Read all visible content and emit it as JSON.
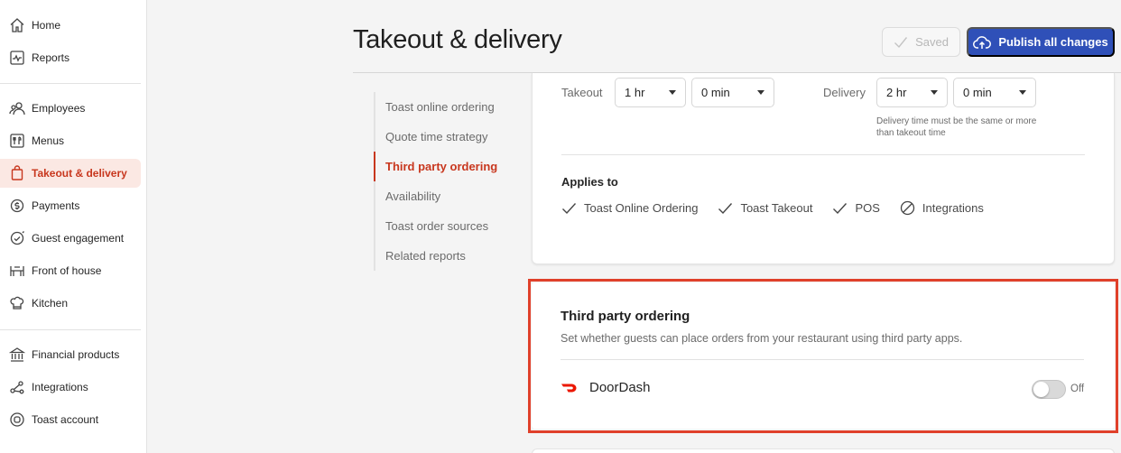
{
  "sidebar": {
    "items": [
      {
        "label": "Home",
        "icon": "home-icon"
      },
      {
        "label": "Reports",
        "icon": "reports-icon"
      },
      {
        "label": "Employees",
        "icon": "employees-icon"
      },
      {
        "label": "Menus",
        "icon": "menus-icon"
      },
      {
        "label": "Takeout & delivery",
        "icon": "takeout-bag-icon",
        "active": true
      },
      {
        "label": "Payments",
        "icon": "payments-icon"
      },
      {
        "label": "Guest engagement",
        "icon": "guest-engagement-icon"
      },
      {
        "label": "Front of house",
        "icon": "front-of-house-icon"
      },
      {
        "label": "Kitchen",
        "icon": "chef-hat-icon"
      },
      {
        "label": "Financial products",
        "icon": "bank-icon"
      },
      {
        "label": "Integrations",
        "icon": "integrations-icon"
      },
      {
        "label": "Toast account",
        "icon": "toast-account-icon"
      }
    ]
  },
  "header": {
    "title": "Takeout & delivery",
    "saved_label": "Saved",
    "publish_label": "Publish all changes"
  },
  "section_nav": [
    {
      "label": "Toast online ordering"
    },
    {
      "label": "Quote time strategy"
    },
    {
      "label": "Third party ordering",
      "active": true
    },
    {
      "label": "Availability"
    },
    {
      "label": "Toast order sources"
    },
    {
      "label": "Related reports"
    }
  ],
  "quote_time": {
    "takeout_label": "Takeout",
    "takeout_hr": "1 hr",
    "takeout_min": "0 min",
    "delivery_label": "Delivery",
    "delivery_hr": "2 hr",
    "delivery_min": "0 min",
    "delivery_hint": "Delivery time must be the same or more than takeout time"
  },
  "applies_to": {
    "title": "Applies to",
    "items": [
      {
        "label": "Toast Online Ordering",
        "icon": "check-icon"
      },
      {
        "label": "Toast Takeout",
        "icon": "check-icon"
      },
      {
        "label": "POS",
        "icon": "check-icon"
      },
      {
        "label": "Integrations",
        "icon": "not-applicable-icon"
      }
    ]
  },
  "third_party": {
    "title": "Third party ordering",
    "description": "Set whether guests can place orders from your restaurant using third party apps.",
    "provider": "DoorDash",
    "toggle_state": "Off"
  },
  "colors": {
    "accent": "#c8371e",
    "publish_button": "#2f50b8",
    "highlight_border": "#e0402a",
    "doordash": "#eb1700"
  }
}
